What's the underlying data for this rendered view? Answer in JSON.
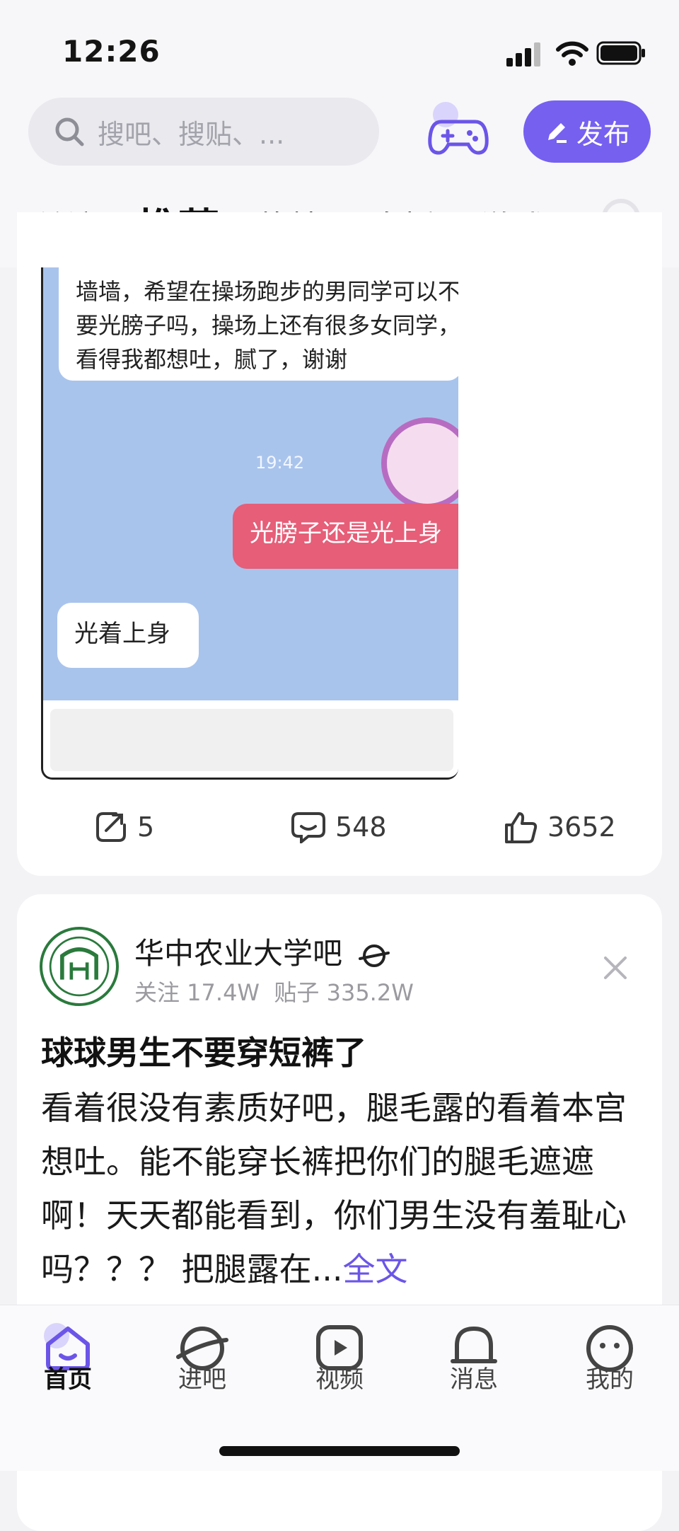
{
  "status_bar": {
    "time": "12:26"
  },
  "header": {
    "search_placeholder": "搜吧、搜贴、...",
    "publish_label": "发布"
  },
  "tabs": [
    {
      "label": "关注"
    },
    {
      "label": "推荐"
    },
    {
      "label": "热榜"
    },
    {
      "label": "直播"
    },
    {
      "label": "游戏"
    }
  ],
  "card1": {
    "chat": {
      "msg1": "墙墙，希望在操场跑步的男同学可以不要光膀子吗，操场上还有很多女同学，看得我都想吐，腻了，谢谢",
      "time": "19:42",
      "msg2": "光膀子还是光上身",
      "msg3": "光着上身"
    },
    "actions": {
      "share": "5",
      "comments": "548",
      "likes": "3652"
    }
  },
  "card2": {
    "forum_name": "华中农业大学吧",
    "follow_stat": "关注 17.4W",
    "post_stat": "贴子 335.2W",
    "title": "球球男生不要穿短裤了",
    "body": "看着很没有素质好吧，腿毛露的看着本宫想吐。能不能穿长裤把你们的腿毛遮遮啊！天天都能看到，你们男生没有羞耻心吗？？？ 把腿露在...",
    "more": "全文"
  },
  "bottom_nav": [
    {
      "label": "首页"
    },
    {
      "label": "进吧"
    },
    {
      "label": "视频"
    },
    {
      "label": "消息"
    },
    {
      "label": "我的"
    }
  ],
  "colors": {
    "accent": "#7560f0",
    "chat_bg": "#a9c4ec",
    "pink_bubble": "#e65e78"
  }
}
